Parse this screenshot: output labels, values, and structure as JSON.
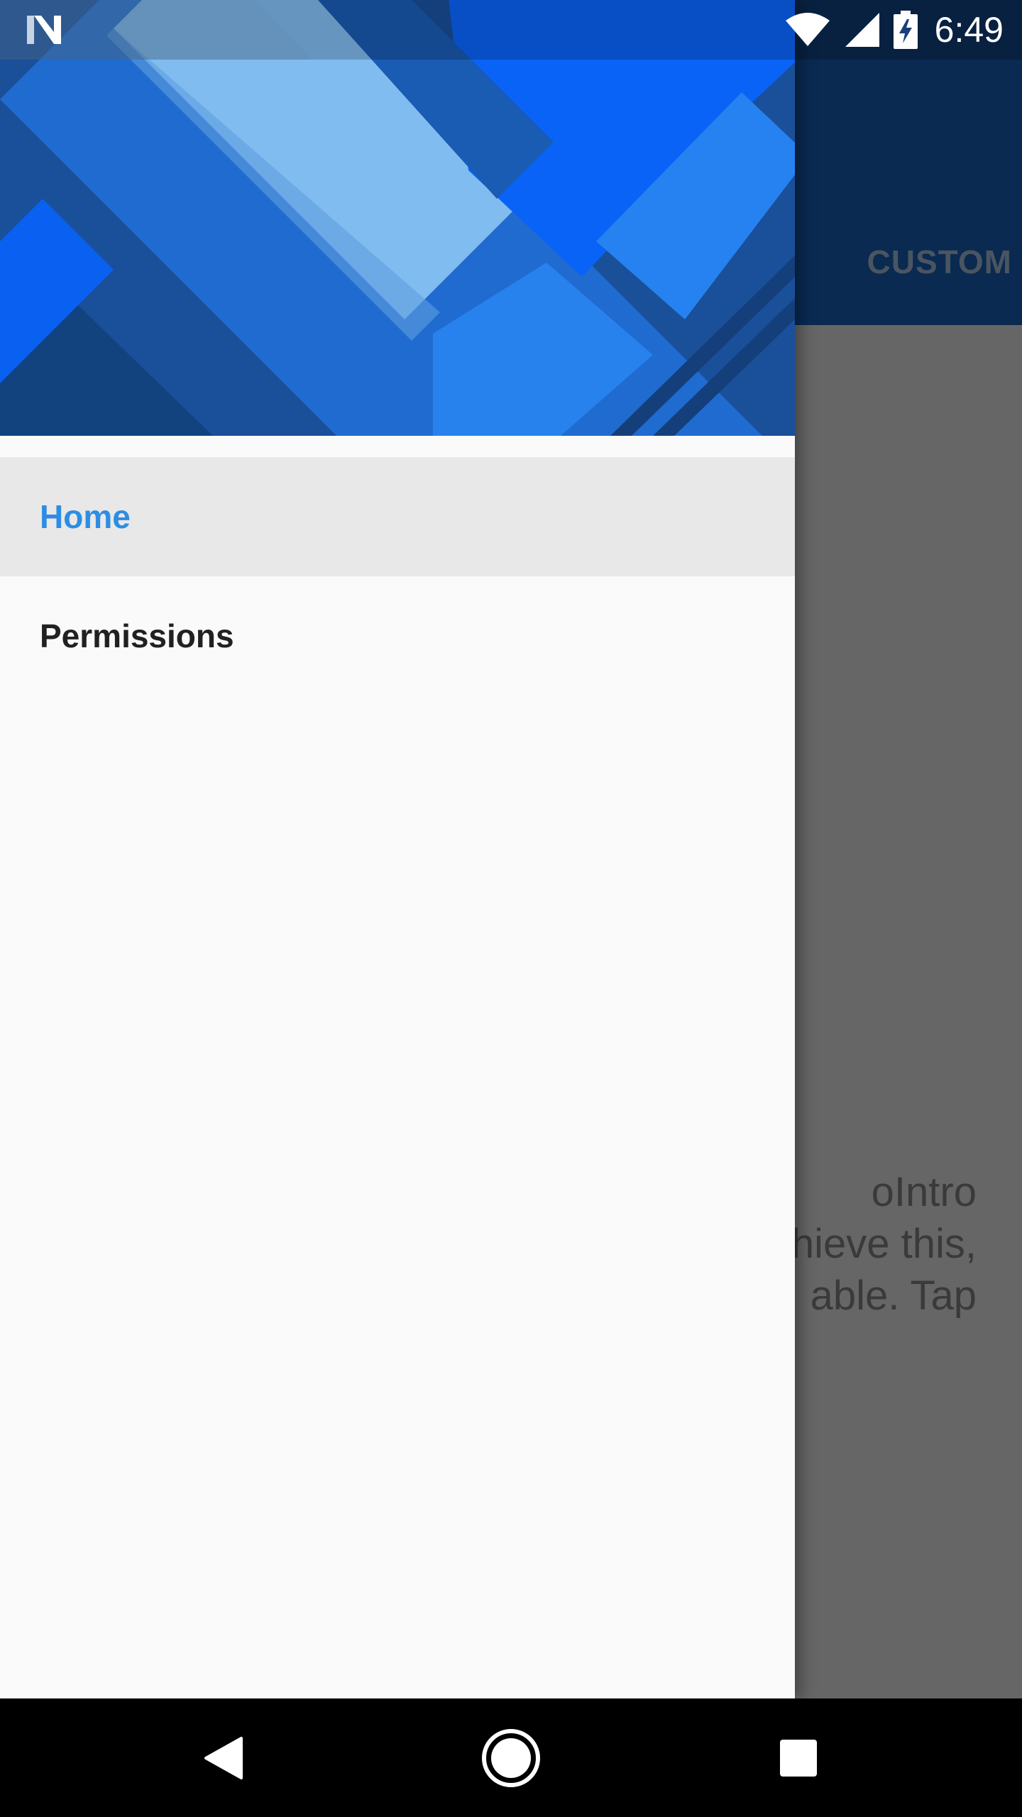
{
  "status_bar": {
    "time": "6:49",
    "icons": [
      "notification-n-icon",
      "wifi-icon",
      "cellular-signal-icon",
      "battery-charging-icon"
    ]
  },
  "background_app": {
    "tab_label": "CUSTOM",
    "body_lines": [
      "oIntro",
      "hieve this,",
      "able. Tap"
    ],
    "toolbar_color": "#0a2a52",
    "scrim_color": "#666666"
  },
  "drawer": {
    "header_image": "material-blue-geometric-banner",
    "items": [
      {
        "label": "Home",
        "active": true
      },
      {
        "label": "Permissions",
        "active": false
      }
    ],
    "accent_color": "#2e8de3"
  },
  "navigation_bar": {
    "buttons": [
      "back-icon",
      "home-icon",
      "recents-icon"
    ]
  }
}
